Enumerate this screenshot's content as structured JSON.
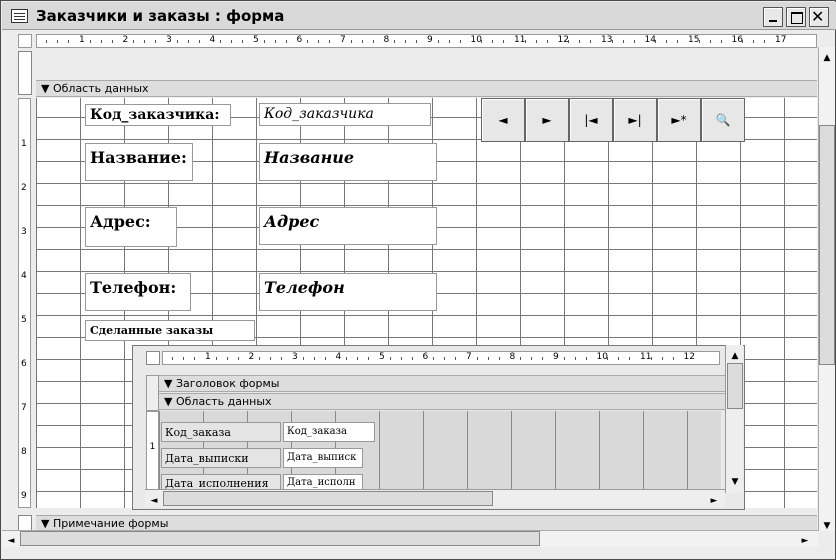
{
  "window": {
    "title": "Заказчики и заказы : форма"
  },
  "ruler": {
    "main_ticks": [
      "1",
      "2",
      "3",
      "4",
      "5",
      "6",
      "7",
      "8",
      "9",
      "10",
      "11",
      "12",
      "13",
      "14",
      "15",
      "16",
      "17"
    ],
    "left_ticks": [
      "1",
      "2",
      "3",
      "4",
      "5",
      "6",
      "7",
      "8",
      "9"
    ],
    "sub_ticks": [
      "1",
      "2",
      "3",
      "4",
      "5",
      "6",
      "7",
      "8",
      "9",
      "10",
      "11",
      "12"
    ]
  },
  "sections": {
    "detail": "Область данных",
    "footer": "Примечание формы"
  },
  "fields": [
    {
      "label": "Код_заказчика:",
      "control": "Код_заказчика"
    },
    {
      "label": "Название:",
      "control": "Название"
    },
    {
      "label": "Адрес:",
      "control": "Адрес"
    },
    {
      "label": "Телефон:",
      "control": "Телефон"
    }
  ],
  "nav_buttons": [
    "◄",
    "►",
    "|◄",
    "►|",
    "►*",
    "🔍"
  ],
  "subform": {
    "label": "Сделанные заказы",
    "header_section": "Заголовок формы",
    "detail_section": "Область данных",
    "fields": [
      {
        "label": "Код_заказа",
        "control": "Код_заказа"
      },
      {
        "label": "Дата_выписки",
        "control": "Дата_выписк"
      },
      {
        "label": "Дата_исполнения",
        "control": "Дата_исполн"
      }
    ]
  },
  "colors": {
    "title_bar": "#d9d9d9",
    "grid": "#777777"
  }
}
